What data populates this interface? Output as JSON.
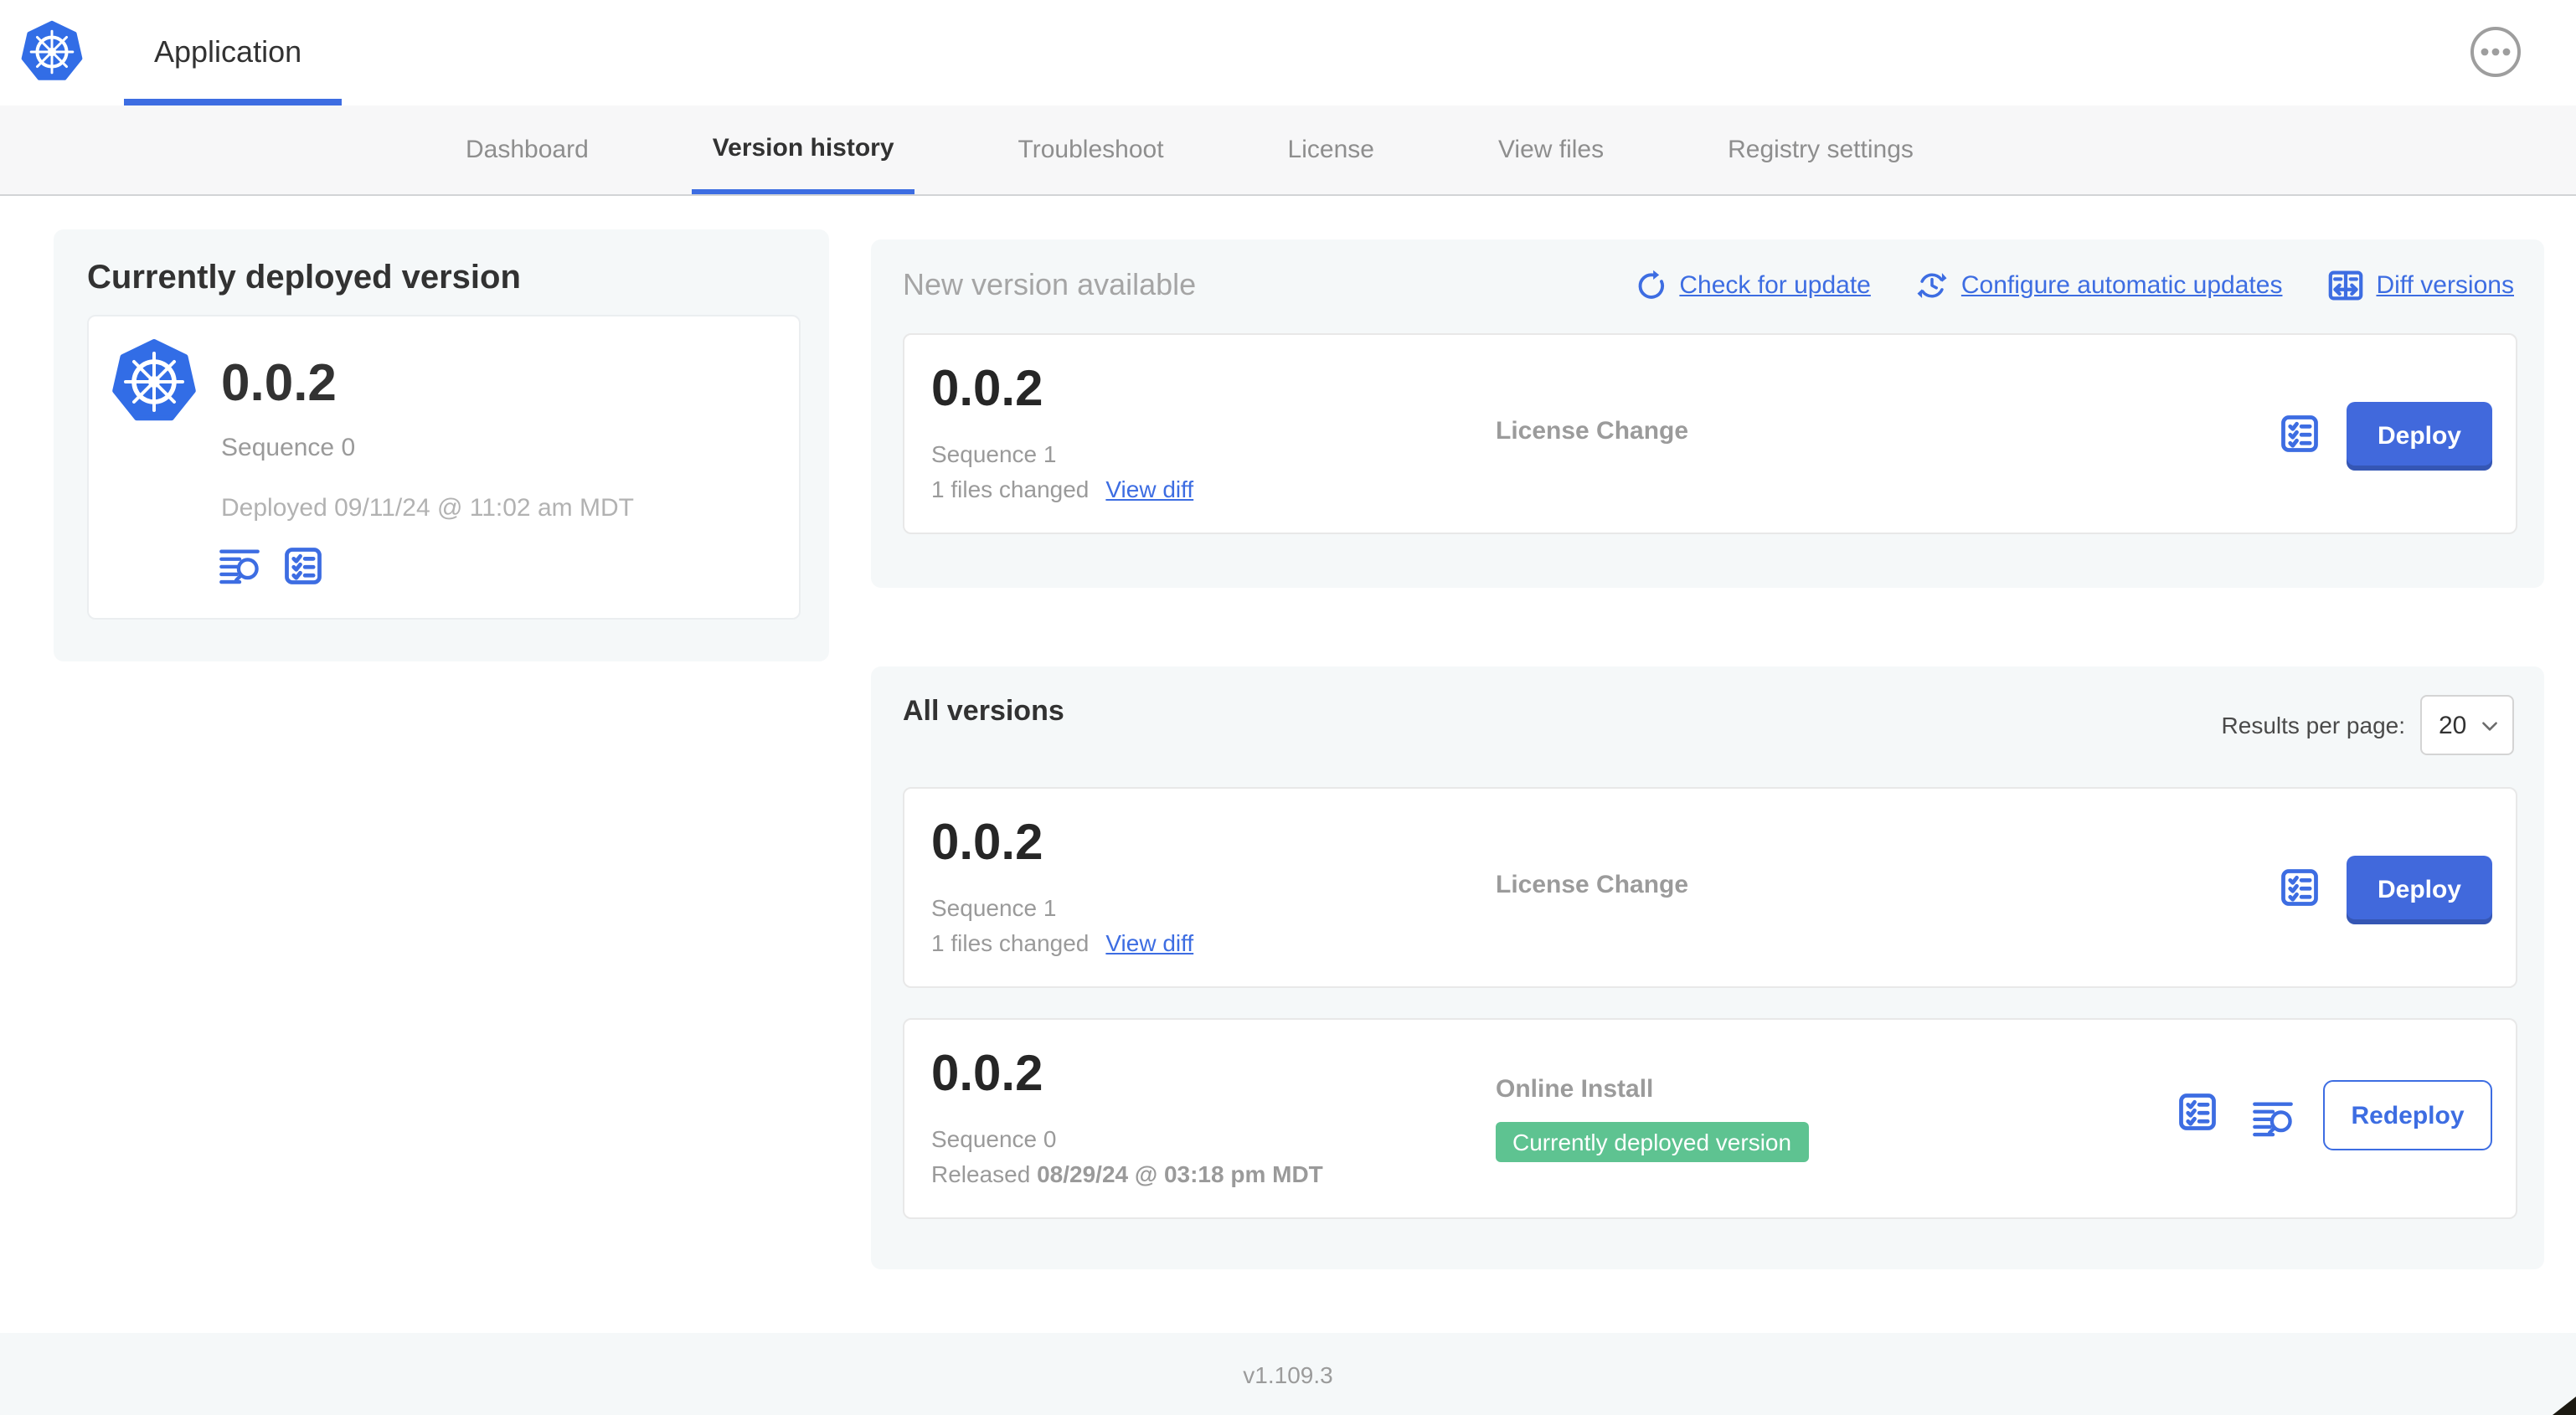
{
  "header": {
    "app_title": "Application"
  },
  "nav": {
    "tabs": [
      {
        "label": "Dashboard",
        "active": false
      },
      {
        "label": "Version history",
        "active": true
      },
      {
        "label": "Troubleshoot",
        "active": false
      },
      {
        "label": "License",
        "active": false
      },
      {
        "label": "View files",
        "active": false
      },
      {
        "label": "Registry settings",
        "active": false
      }
    ]
  },
  "deployed_panel": {
    "title": "Currently deployed version",
    "version": "0.0.2",
    "sequence": "Sequence 0",
    "deployed_at": "Deployed 09/11/24 @ 11:02 am MDT"
  },
  "new_version_section": {
    "title": "New version available",
    "check_for_update": "Check for update",
    "configure_auto_updates": "Configure automatic updates",
    "diff_versions": "Diff versions",
    "card": {
      "version": "0.0.2",
      "sequence": "Sequence 1",
      "files_changed": "1 files changed",
      "view_diff": "View diff",
      "source": "License Change",
      "action": "Deploy"
    }
  },
  "all_versions_section": {
    "title": "All versions",
    "results_per_page_label": "Results per page:",
    "results_per_page": "20",
    "rows": [
      {
        "version": "0.0.2",
        "sequence": "Sequence 1",
        "files_changed": "1 files changed",
        "view_diff": "View diff",
        "source": "License Change",
        "action": "Deploy"
      },
      {
        "version": "0.0.2",
        "sequence": "Sequence 0",
        "released_prefix": "Released",
        "released_date": "08/29/24 @ 03:18 pm MDT",
        "source": "Online Install",
        "badge": "Currently deployed version",
        "action": "Redeploy"
      }
    ]
  },
  "footer": {
    "version": "v1.109.3"
  },
  "colors": {
    "accent_blue": "#3d6de2",
    "k8s_blue": "#326de6",
    "badge_green": "#5ec391",
    "panel_bg": "#f5f8f9"
  }
}
